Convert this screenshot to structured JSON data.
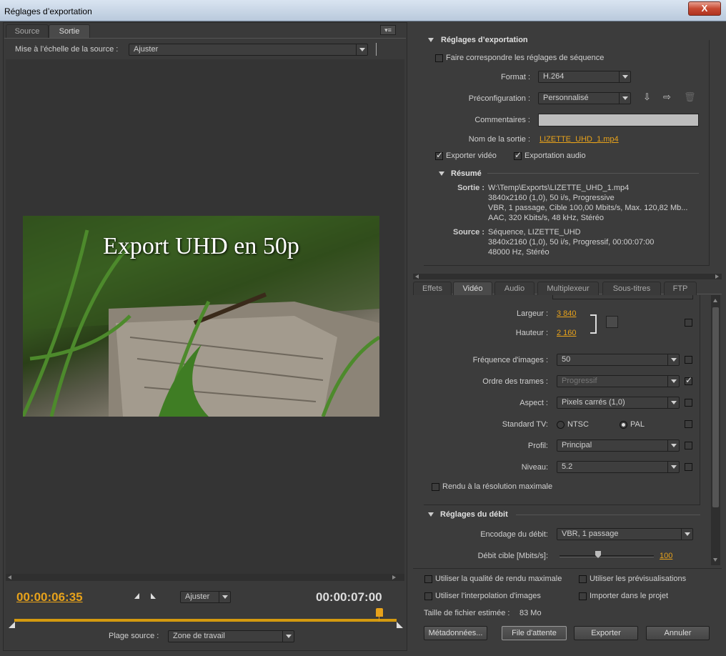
{
  "window": {
    "title": "Réglages d’exportation",
    "close_label": "X"
  },
  "left": {
    "tabs": [
      "Source",
      "Sortie"
    ],
    "scale_label": "Mise à l’échelle de la source :",
    "scale_value": "Ajuster",
    "preview_title": "Export UHD en 50p",
    "timecode_current": "00:00:06:35",
    "timecode_total": "00:00:07:00",
    "fit_value": "Ajuster",
    "range_label": "Plage source :",
    "range_value": "Zone de travail",
    "playhead_fraction": 0.94,
    "colors": {
      "timecode": "#e7a21b",
      "timeline": "#d49a0f"
    }
  },
  "export": {
    "section_title": "Réglages d’exportation",
    "match_seq_label": "Faire correspondre les réglages de séquence",
    "format_label": "Format :",
    "format_value": "H.264",
    "preset_label": "Préconfiguration :",
    "preset_value": "Personnalisé",
    "comments_label": "Commentaires :",
    "output_name_label": "Nom de la sortie :",
    "output_name_value": "LIZETTE_UHD_1.mp4",
    "export_video_label": "Exporter vidéo",
    "export_audio_label": "Exportation audio",
    "summary_title": "Résumé",
    "output_label": "Sortie :",
    "output_lines": [
      "W:\\Temp\\Exports\\LIZETTE_UHD_1.mp4",
      "3840x2160 (1,0), 50 i/s, Progressive",
      "VBR, 1 passage, Cible 100,00  Mbits/s, Max. 120,82  Mb...",
      "AAC, 320  Kbits/s, 48  kHz, Stéréo"
    ],
    "source_label": "Source :",
    "source_lines": [
      "Séquence, LIZETTE_UHD",
      "3840x2160 (1,0), 50  i/s, Progressif, 00:00:07:00",
      "48000 Hz, Stéréo"
    ]
  },
  "tabs2": [
    "Effets",
    "Vidéo",
    "Audio",
    "Multiplexeur",
    "Sous-titres",
    "FTP"
  ],
  "video": {
    "width_label": "Largeur :",
    "width_value": "3 840",
    "height_label": "Hauteur :",
    "height_value": "2 160",
    "fps_label": "Fréquence d'images :",
    "fps_value": "50",
    "field_label": "Ordre des trames :",
    "field_value": "Progressif",
    "aspect_label": "Aspect :",
    "aspect_value": "Pixels carrés (1,0)",
    "tv_label": "Standard TV:",
    "ntsc": "NTSC",
    "pal": "PAL",
    "profile_label": "Profil:",
    "profile_value": "Principal",
    "level_label": "Niveau:",
    "level_value": "5.2",
    "max_render_label": "Rendu à la résolution maximale",
    "bitrate_title": "Réglages du débit",
    "bitrate_enc_label": "Encodage du débit:",
    "bitrate_enc_value": "VBR, 1 passage",
    "target_label": "Débit cible [Mbits/s]:",
    "target_value": "100"
  },
  "bottom": {
    "max_quality": "Utiliser la qualité de rendu maximale",
    "previews": "Utiliser les prévisualisations",
    "interp": "Utiliser l'interpolation d'images",
    "import": "Importer dans le projet",
    "filesize_label": "Taille de fichier estimée :",
    "filesize_value": "83 Mo",
    "meta_btn": "Métadonnées...",
    "queue_btn": "File d'attente",
    "export_btn": "Exporter",
    "cancel_btn": "Annuler"
  }
}
